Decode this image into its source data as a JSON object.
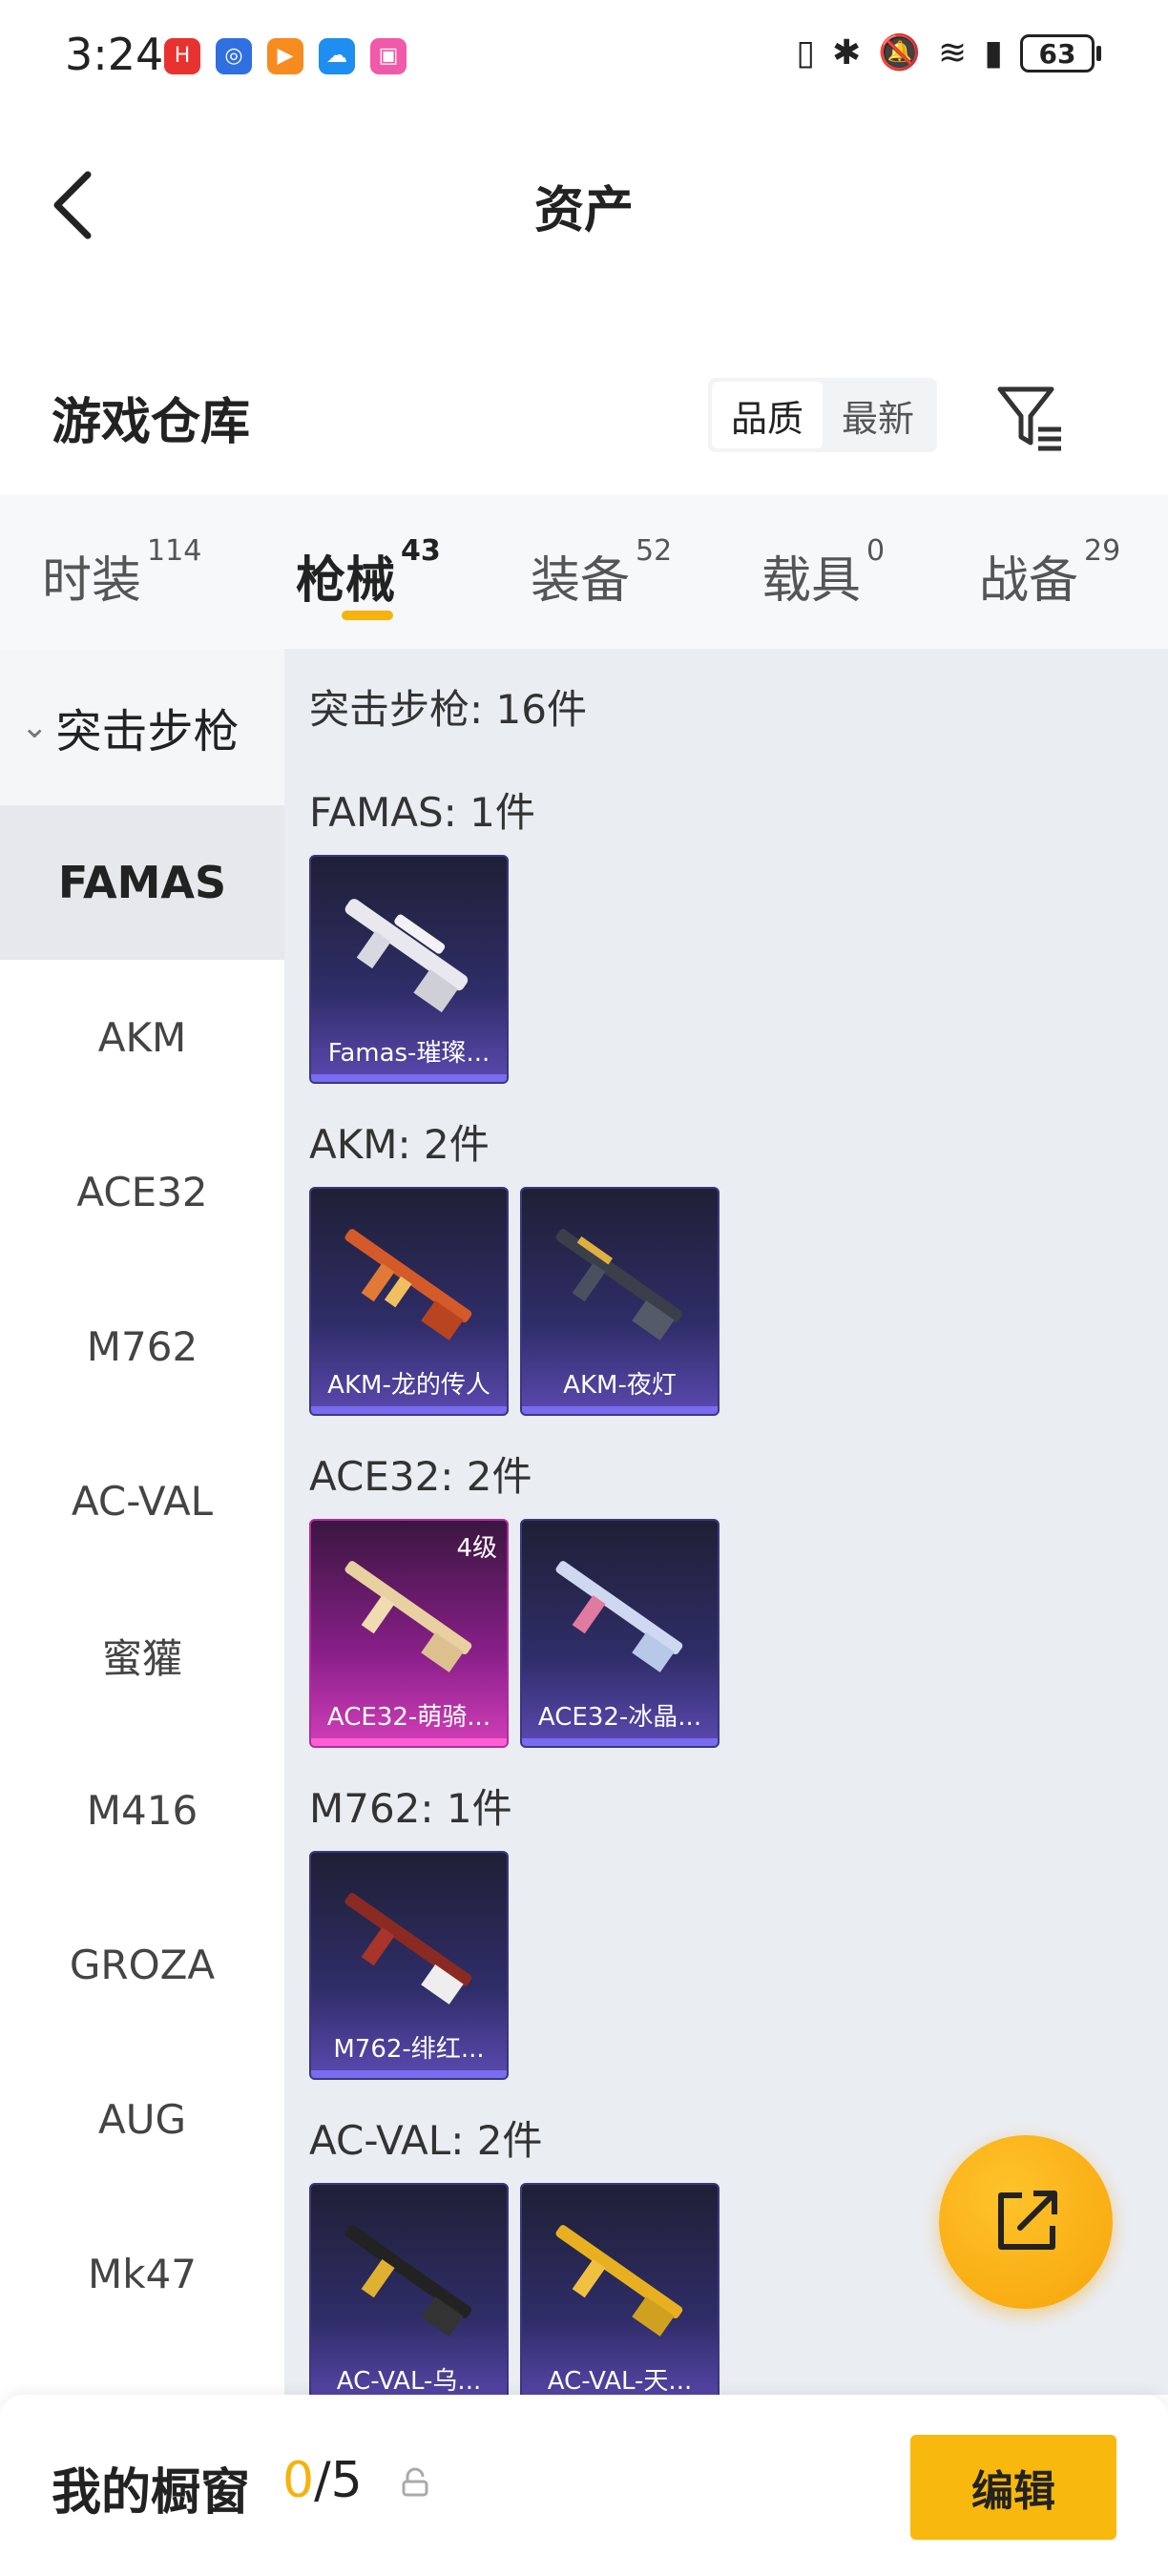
{
  "status_bar": {
    "time": "3:24",
    "app_icons": [
      {
        "name": "huawei-app-icon",
        "color": "#e8322f",
        "glyph": "H"
      },
      {
        "name": "bulb-app-icon",
        "color": "#2f6fe0",
        "glyph": "◎"
      },
      {
        "name": "video-app-icon",
        "color": "#f68b1f",
        "glyph": "▶"
      },
      {
        "name": "cloud-app-icon",
        "color": "#1e8ef0",
        "glyph": "☁"
      },
      {
        "name": "paint-app-icon",
        "color": "#f05aa8",
        "glyph": "▣"
      }
    ],
    "battery": "63"
  },
  "header": {
    "title": "资产"
  },
  "section": {
    "title": "游戏仓库",
    "sort_options": [
      "品质",
      "最新"
    ],
    "active_sort": "品质"
  },
  "tabs": [
    {
      "label": "时装",
      "count": "114",
      "active": false
    },
    {
      "label": "枪械",
      "count": "43",
      "active": true
    },
    {
      "label": "装备",
      "count": "52",
      "active": false
    },
    {
      "label": "载具",
      "count": "0",
      "active": false
    },
    {
      "label": "战备",
      "count": "29",
      "active": false
    }
  ],
  "sidebar": {
    "category": "突击步枪",
    "items": [
      "FAMAS",
      "AKM",
      "ACE32",
      "M762",
      "AC-VAL",
      "蜜獾",
      "M416",
      "GROZA",
      "AUG",
      "Mk47"
    ],
    "active_item": "FAMAS"
  },
  "content": {
    "title": "突击步枪: 16件",
    "groups": [
      {
        "title": "FAMAS: 1件",
        "items": [
          {
            "label": "Famas-璀璨...",
            "tier": "purple"
          }
        ]
      },
      {
        "title": "AKM: 2件",
        "items": [
          {
            "label": "AKM-龙的传人",
            "tier": "purple"
          },
          {
            "label": "AKM-夜灯",
            "tier": "purple"
          }
        ]
      },
      {
        "title": "ACE32: 2件",
        "items": [
          {
            "label": "ACE32-萌骑...",
            "tier": "pink",
            "level": "4级"
          },
          {
            "label": "ACE32-冰晶...",
            "tier": "purple"
          }
        ]
      },
      {
        "title": "M762: 1件",
        "items": [
          {
            "label": "M762-绯红...",
            "tier": "purple"
          }
        ]
      },
      {
        "title": "AC-VAL: 2件",
        "items": [
          {
            "label": "AC-VAL-乌...",
            "tier": "purple"
          },
          {
            "label": "AC-VAL-天...",
            "tier": "purple"
          }
        ]
      }
    ]
  },
  "bottom": {
    "showcase_title": "我的橱窗",
    "showcase_used": "0",
    "showcase_total": "/5",
    "edit_label": "编辑"
  }
}
